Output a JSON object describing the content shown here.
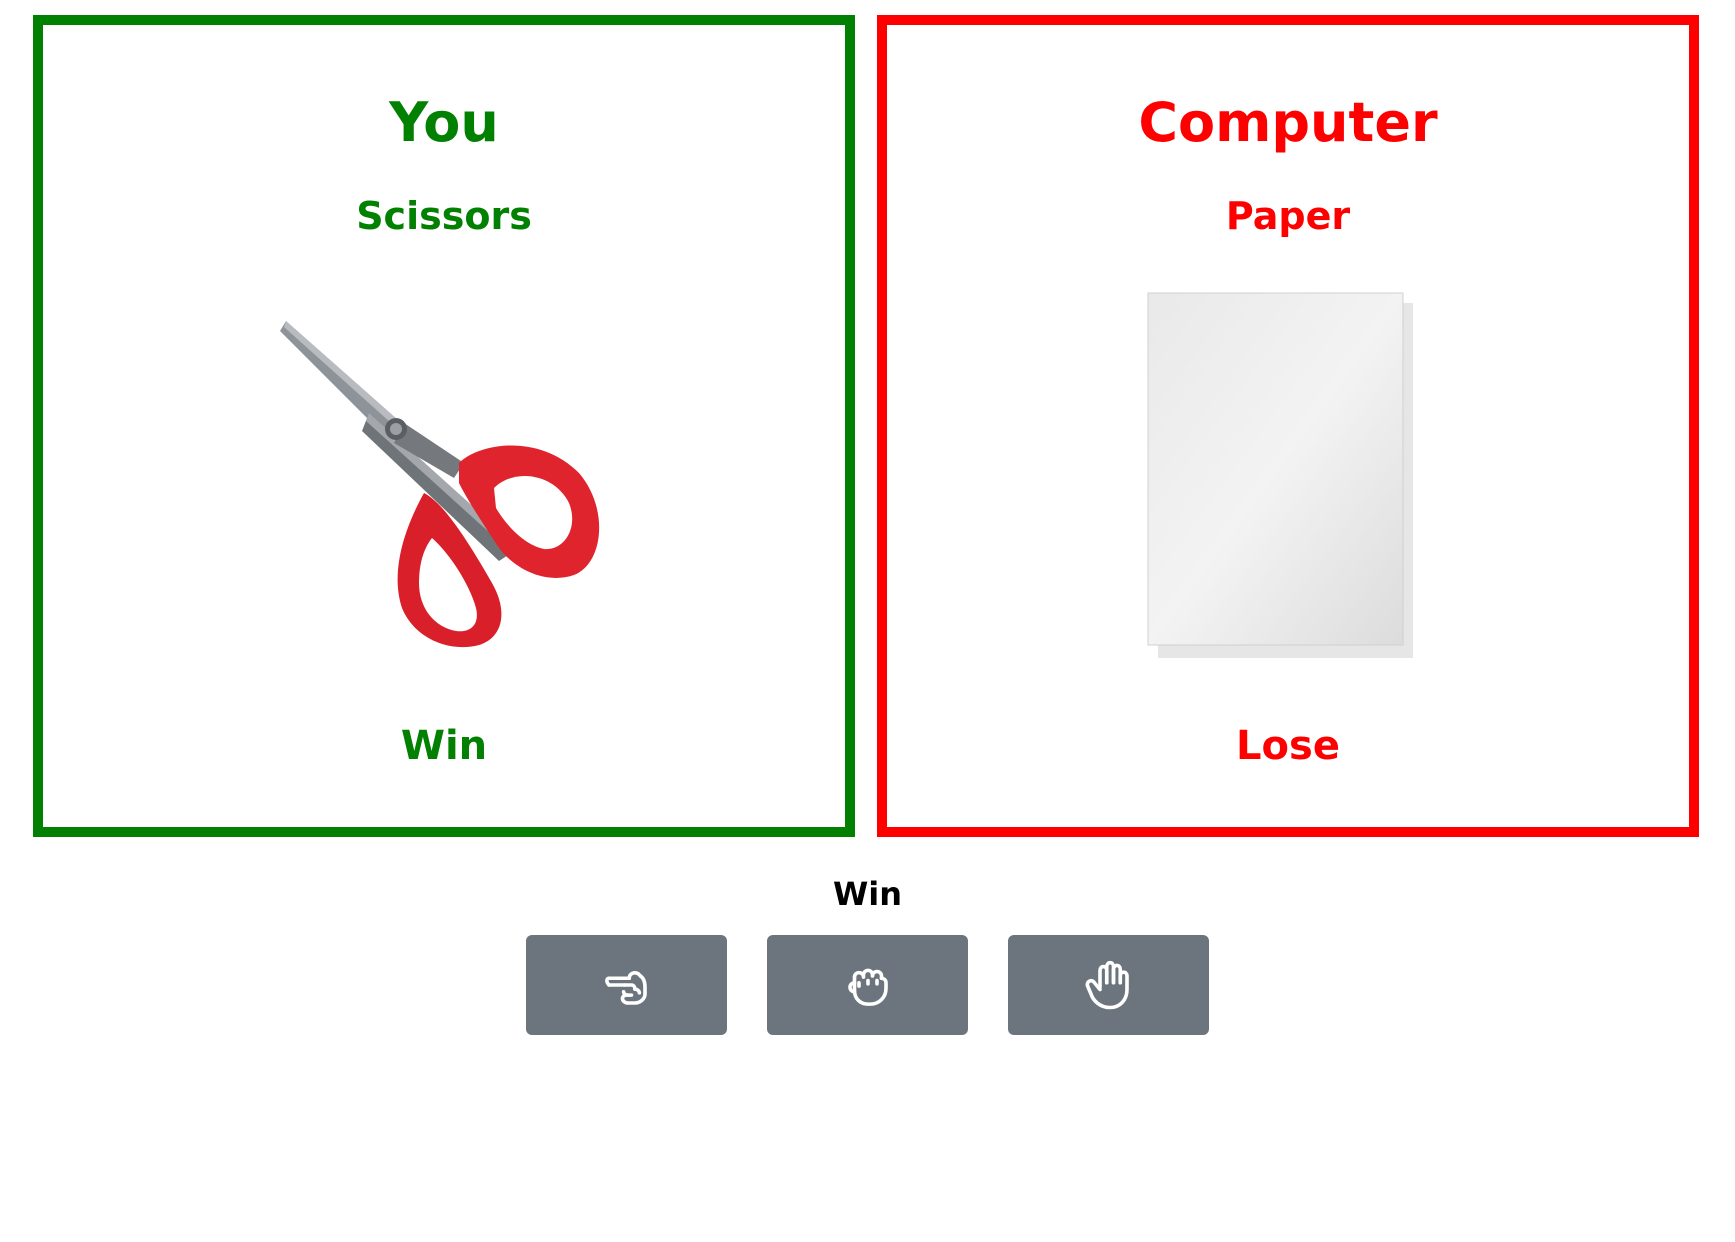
{
  "player": {
    "title": "You",
    "choice": "Scissors",
    "result": "Win",
    "color": "#028002",
    "image_icon": "scissors-image"
  },
  "computer": {
    "title": "Computer",
    "choice": "Paper",
    "result": "Lose",
    "color": "#fe0000",
    "image_icon": "paper-image"
  },
  "round_result": "Win",
  "buttons": [
    {
      "name": "scissors",
      "icon": "hand-scissors-icon"
    },
    {
      "name": "rock",
      "icon": "hand-rock-icon"
    },
    {
      "name": "paper",
      "icon": "hand-paper-icon"
    }
  ],
  "button_color": "#6c757d"
}
